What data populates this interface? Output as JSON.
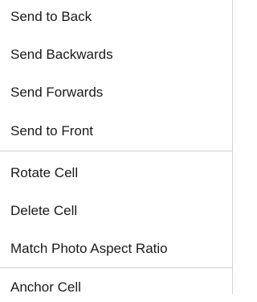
{
  "context_menu": {
    "groups": [
      {
        "items": [
          {
            "label": "Send to Back"
          },
          {
            "label": "Send Backwards"
          },
          {
            "label": "Send Forwards"
          },
          {
            "label": "Send to Front"
          }
        ]
      },
      {
        "items": [
          {
            "label": "Rotate Cell"
          },
          {
            "label": "Delete Cell"
          },
          {
            "label": "Match Photo Aspect Ratio"
          }
        ]
      },
      {
        "items": [
          {
            "label": "Anchor Cell"
          }
        ]
      }
    ]
  }
}
